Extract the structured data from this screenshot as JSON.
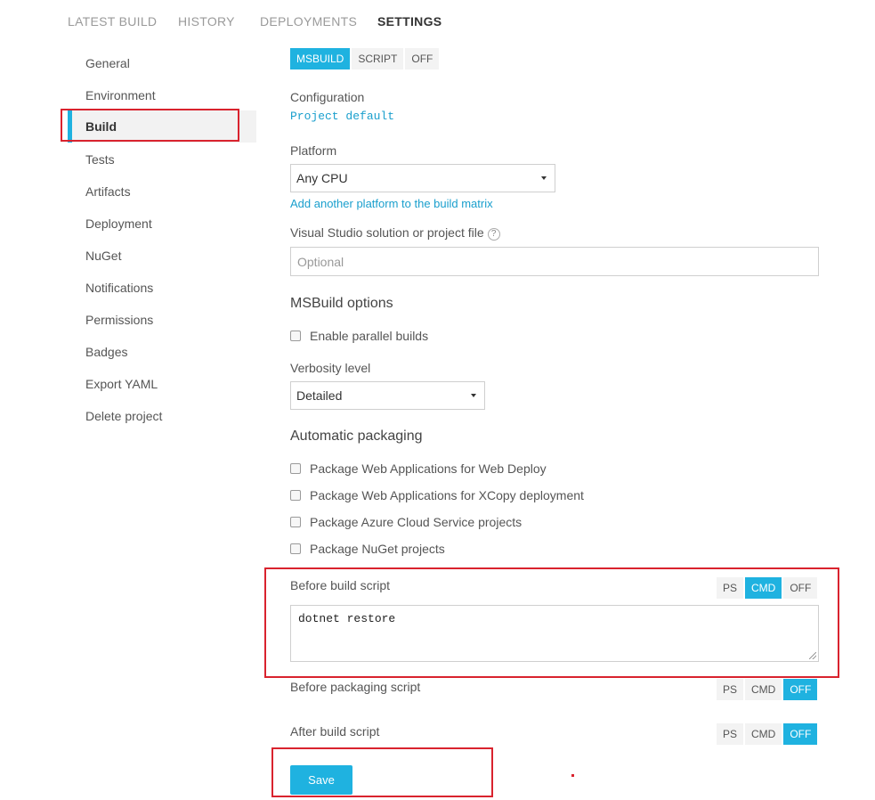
{
  "tabs": [
    {
      "label": "LATEST BUILD"
    },
    {
      "label": "HISTORY"
    },
    {
      "label": "DEPLOYMENTS"
    },
    {
      "label": "SETTINGS"
    }
  ],
  "sidebar": {
    "items": [
      {
        "label": "General"
      },
      {
        "label": "Environment"
      },
      {
        "label": "Build"
      },
      {
        "label": "Tests"
      },
      {
        "label": "Artifacts"
      },
      {
        "label": "Deployment"
      },
      {
        "label": "NuGet"
      },
      {
        "label": "Notifications"
      },
      {
        "label": "Permissions"
      },
      {
        "label": "Badges"
      },
      {
        "label": "Export YAML"
      },
      {
        "label": "Delete project"
      }
    ],
    "active": "Build"
  },
  "build_mode": {
    "options": [
      "MSBUILD",
      "SCRIPT",
      "OFF"
    ],
    "selected": "MSBUILD"
  },
  "configuration": {
    "label": "Configuration",
    "value": "Project default"
  },
  "platform": {
    "label": "Platform",
    "value": "Any CPU",
    "add_link": "Add another platform to the build matrix"
  },
  "solution_file": {
    "label": "Visual Studio solution or project file",
    "help_icon": "?",
    "placeholder": "Optional"
  },
  "msbuild_options": {
    "heading": "MSBuild options",
    "parallel_label": "Enable parallel builds",
    "verbosity_label": "Verbosity level",
    "verbosity_value": "Detailed"
  },
  "packaging": {
    "heading": "Automatic packaging",
    "options": [
      "Package Web Applications for Web Deploy",
      "Package Web Applications for XCopy deployment",
      "Package Azure Cloud Service projects",
      "Package NuGet projects"
    ]
  },
  "scripts": {
    "before_build": {
      "label": "Before build script",
      "options": [
        "PS",
        "CMD",
        "OFF"
      ],
      "selected": "CMD",
      "content": "dotnet restore"
    },
    "before_packaging": {
      "label": "Before packaging script",
      "options": [
        "PS",
        "CMD",
        "OFF"
      ],
      "selected": "OFF"
    },
    "after_build": {
      "label": "After build script",
      "options": [
        "PS",
        "CMD",
        "OFF"
      ],
      "selected": "OFF"
    }
  },
  "save_label": "Save",
  "colors": {
    "accent": "#1fb2e0",
    "highlight": "#d9232e"
  }
}
